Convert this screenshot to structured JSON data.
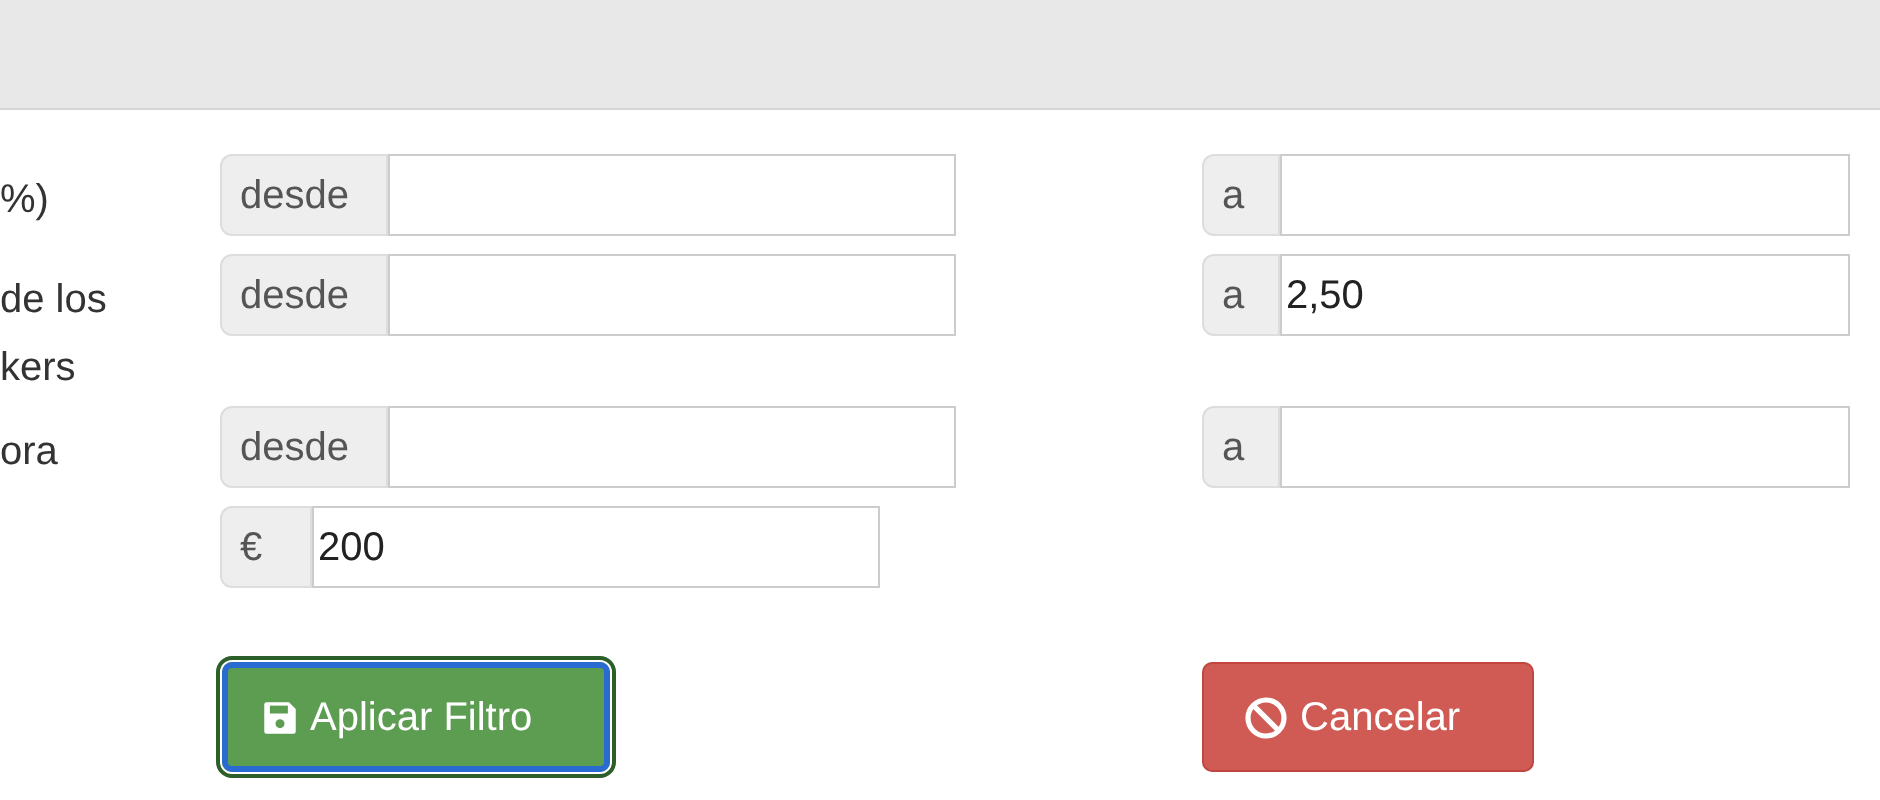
{
  "rows": [
    {
      "label": [
        "%)"
      ],
      "from": {
        "addon": "desde"
      },
      "to": {
        "addon": "a"
      }
    },
    {
      "label": [
        "de los",
        "kers"
      ],
      "from": {
        "addon": "desde"
      },
      "to": {
        "addon": "a",
        "value": "2,50"
      }
    },
    {
      "label": [
        "ora"
      ],
      "from": {
        "addon": "desde"
      },
      "to": {
        "addon": "a"
      }
    },
    {
      "label": [],
      "from": {
        "addon": "€",
        "value": "200"
      }
    }
  ],
  "buttons": [
    {
      "kind": "apply",
      "label": "Aplicar Filtro",
      "focused": true
    },
    {
      "kind": "cancel",
      "label": "Cancelar",
      "focused": false
    }
  ]
}
